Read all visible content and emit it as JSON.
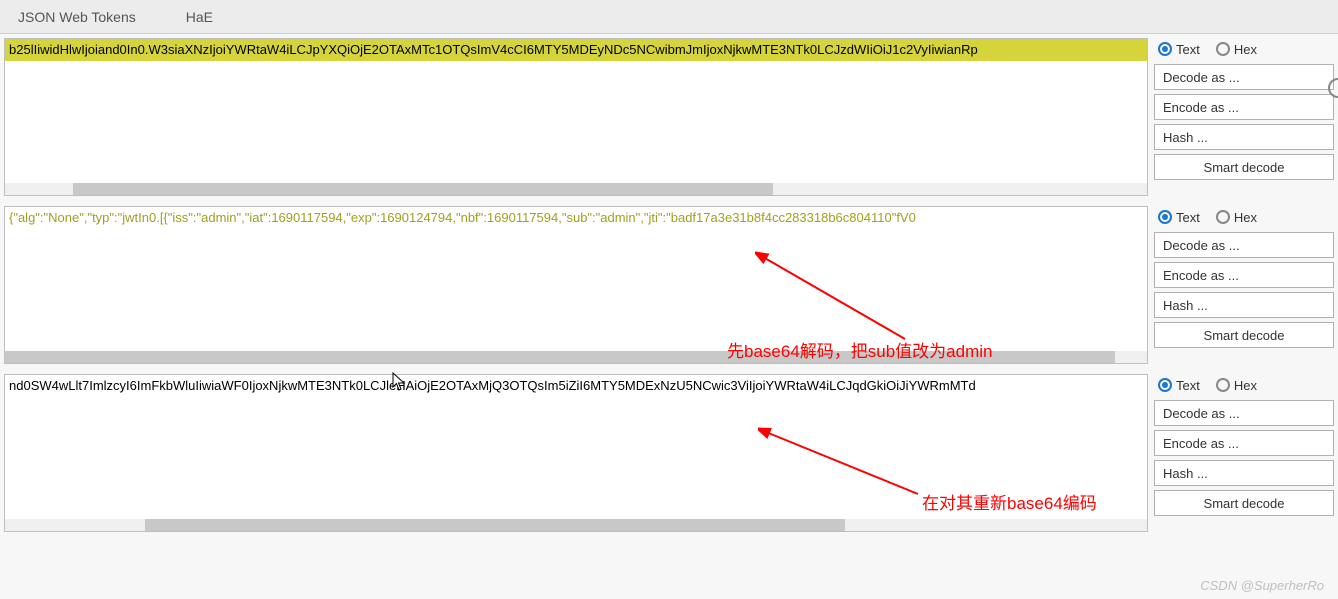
{
  "tabs": {
    "jwt": "JSON Web Tokens",
    "hae": "HaE"
  },
  "radios": {
    "text": "Text",
    "hex": "Hex"
  },
  "buttons": {
    "decode_as": "Decode as ...",
    "encode_as": "Encode as ...",
    "hash": "Hash ...",
    "smart_decode": "Smart decode"
  },
  "panel1": {
    "text": "b25lIiwidHlwIjoiand0In0.W3siaXNzIjoiYWRtaW4iLCJpYXQiOjE2OTAxMTc1OTQsImV4cCI6MTY5MDEyNDc5NCwibmJmIjoxNjkwMTE3NTk0LCJzdWIiOiJ1c2VyIiwianRp"
  },
  "panel2": {
    "text": "{\"alg\":\"None\",\"typ\":\"jwtIn0.[{\"iss\":\"admin\",\"iat\":1690117594,\"exp\":1690124794,\"nbf\":1690117594,\"sub\":\"admin\",\"jti\":\"badf17a3e31b8f4cc283318b6c804110\"fV0"
  },
  "panel3": {
    "text": "nd0SW4wLlt7ImlzcyI6ImFkbWluIiwiaWF0IjoxNjkwMTE3NTk0LCJleHAiOjE2OTAxMjQ3OTQsIm5iZiI6MTY5MDExNzU5NCwic3ViIjoiYWRtaW4iLCJqdGkiOiJiYWRmMTd"
  },
  "annotations": {
    "a1": "先base64解码，把sub值改为admin",
    "a2": "在对其重新base64编码"
  },
  "watermark": "CSDN @SuperherRo"
}
